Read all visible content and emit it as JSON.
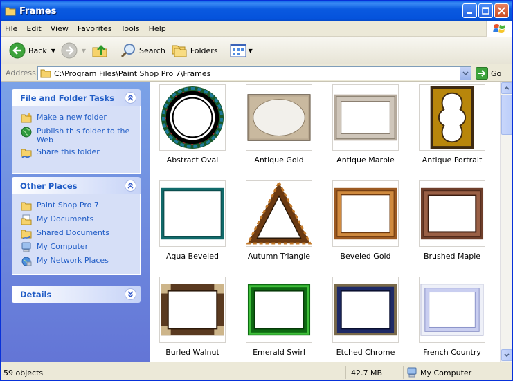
{
  "window": {
    "title": "Frames"
  },
  "menu": [
    "File",
    "Edit",
    "View",
    "Favorites",
    "Tools",
    "Help"
  ],
  "toolbar": {
    "back": "Back",
    "search": "Search",
    "folders": "Folders"
  },
  "address": {
    "label": "Address",
    "path": "C:\\Program Files\\Paint Shop Pro 7\\Frames",
    "go": "Go"
  },
  "tasks": {
    "title": "File and Folder Tasks",
    "items": [
      "Make a new folder",
      "Publish this folder to the Web",
      "Share this folder"
    ]
  },
  "places": {
    "title": "Other Places",
    "items": [
      "Paint Shop Pro 7",
      "My Documents",
      "Shared Documents",
      "My Computer",
      "My Network Places"
    ]
  },
  "details": {
    "title": "Details"
  },
  "files": [
    "Abstract Oval",
    "Antique Gold",
    "Antique Marble",
    "Antique Portrait",
    "Aqua Beveled",
    "Autumn Triangle",
    "Beveled Gold",
    "Brushed Maple",
    "Burled Walnut",
    "Emerald Swirl",
    "Etched Chrome",
    "French Country"
  ],
  "status": {
    "count": "59 objects",
    "size": "42.7 MB",
    "location": "My Computer"
  },
  "colors": {
    "titlebar": "#0A5AE0",
    "taskpane": "#7BA2E7",
    "link": "#215DC6"
  }
}
